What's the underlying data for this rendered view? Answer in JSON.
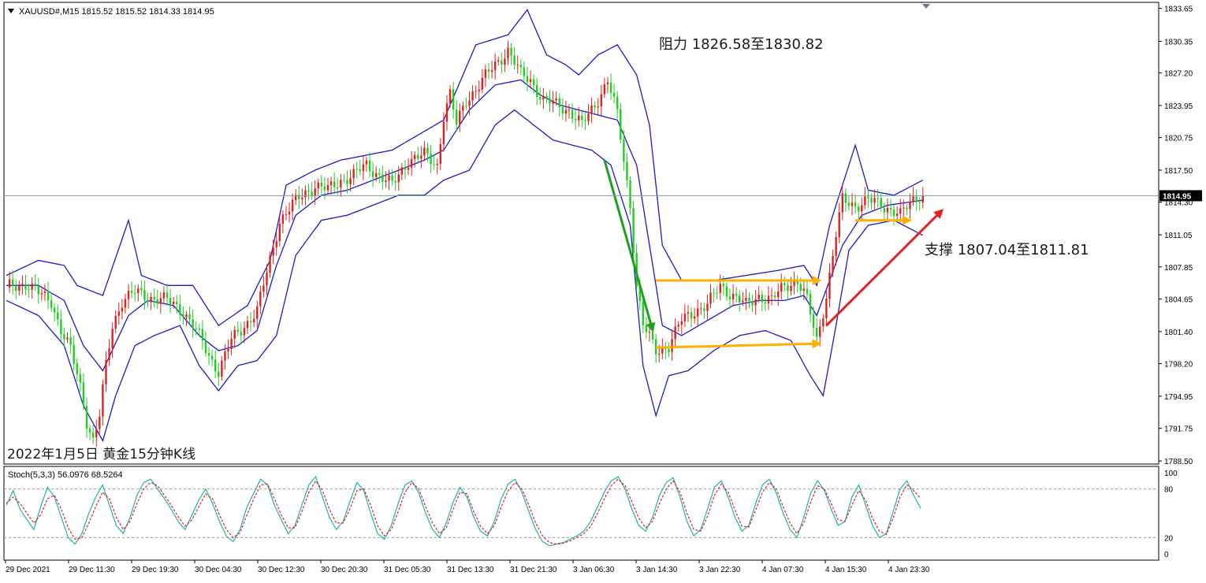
{
  "header": {
    "symbol_info": "XAUUSD#,M15  1815.52 1815.52 1814.33 1814.95",
    "current_price_label": "1814.95",
    "caption": "2022年1月5日 黄金15分钟K线"
  },
  "annotations": {
    "resistance": "阻力 1826.58至1830.82",
    "support": "支撑 1807.04至1811.81"
  },
  "colors": {
    "bull_candle": "#e02020",
    "bear_candle": "#22cc22",
    "bollinger": "#1a1acc",
    "current_price_line": "#7a9aaa",
    "price_badge": "#000000",
    "stoch_main": "#20b2aa",
    "stoch_signal": "#e02020",
    "arrow_down": "#1ea01e",
    "arrow_up": "#e82020",
    "arrow_horizontal": "#ffb000"
  },
  "chart_data": [
    {
      "type": "candlestick",
      "symbol": "XAUUSD#",
      "timeframe": "M15",
      "ylim": [
        1788.5,
        1834.0
      ],
      "y_ticks": [
        "1833.65",
        "1830.35",
        "1827.20",
        "1823.95",
        "1820.75",
        "1817.50",
        "1814.30",
        "1811.05",
        "1807.85",
        "1804.65",
        "1801.40",
        "1798.20",
        "1794.95",
        "1791.75",
        "1788.50"
      ],
      "x_ticks": [
        "29 Dec 2021",
        "29 Dec 11:30",
        "29 Dec 19:30",
        "30 Dec 04:30",
        "30 Dec 12:30",
        "30 Dec 20:30",
        "31 Dec 05:30",
        "31 Dec 13:30",
        "31 Dec 21:30",
        "3 Jan 06:30",
        "3 Jan 14:30",
        "3 Jan 22:30",
        "4 Jan 07:30",
        "4 Jan 15:30",
        "4 Jan 23:30"
      ],
      "current_price": 1814.95,
      "close_path": [
        [
          0,
          1805.8
        ],
        [
          6,
          1806.2
        ],
        [
          10,
          1805.2
        ],
        [
          14,
          1804.5
        ],
        [
          17,
          1801.5
        ],
        [
          20,
          1799.5
        ],
        [
          23,
          1796
        ],
        [
          25,
          1792.5
        ],
        [
          27,
          1790.5
        ],
        [
          29,
          1793
        ],
        [
          31,
          1798
        ],
        [
          33,
          1802
        ],
        [
          36,
          1804.5
        ],
        [
          40,
          1805.3
        ],
        [
          45,
          1804.8
        ],
        [
          50,
          1804.5
        ],
        [
          55,
          1803.5
        ],
        [
          59,
          1801.5
        ],
        [
          63,
          1799
        ],
        [
          66,
          1797.5
        ],
        [
          70,
          1800.5
        ],
        [
          74,
          1802
        ],
        [
          78,
          1803.5
        ],
        [
          82,
          1808.5
        ],
        [
          85,
          1812.5
        ],
        [
          89,
          1814
        ],
        [
          92,
          1815
        ],
        [
          96,
          1816
        ],
        [
          100,
          1815.5
        ],
        [
          104,
          1816.5
        ],
        [
          108,
          1817
        ],
        [
          112,
          1818
        ],
        [
          116,
          1817
        ],
        [
          120,
          1816
        ],
        [
          125,
          1818.5
        ],
        [
          130,
          1819
        ],
        [
          134,
          1818
        ],
        [
          136,
          1823
        ],
        [
          138,
          1825
        ],
        [
          140,
          1822
        ],
        [
          143,
          1824.5
        ],
        [
          147,
          1826
        ],
        [
          152,
          1828
        ],
        [
          156,
          1829.5
        ],
        [
          160,
          1827
        ],
        [
          163,
          1826.5
        ],
        [
          167,
          1824.5
        ],
        [
          171,
          1824
        ],
        [
          175,
          1823.5
        ],
        [
          179,
          1822
        ],
        [
          183,
          1824
        ],
        [
          187,
          1826.5
        ],
        [
          190,
          1823
        ],
        [
          192,
          1818.5
        ],
        [
          194,
          1814
        ],
        [
          196,
          1806
        ],
        [
          198,
          1802
        ],
        [
          202,
          1799.5
        ],
        [
          206,
          1800
        ],
        [
          210,
          1802.5
        ],
        [
          214,
          1803.5
        ],
        [
          218,
          1804
        ],
        [
          222,
          1806
        ],
        [
          226,
          1805
        ],
        [
          230,
          1804
        ],
        [
          234,
          1805
        ],
        [
          238,
          1804.5
        ],
        [
          242,
          1806
        ],
        [
          246,
          1806.5
        ],
        [
          249,
          1804.5
        ],
        [
          252,
          1800.5
        ],
        [
          255,
          1805
        ],
        [
          258,
          1811
        ],
        [
          260,
          1814.5
        ],
        [
          264,
          1814
        ],
        [
          268,
          1814.5
        ],
        [
          272,
          1814
        ],
        [
          276,
          1813.5
        ],
        [
          278,
          1813
        ],
        [
          282,
          1814.5
        ],
        [
          284,
          1815
        ],
        [
          285,
          1814.95
        ]
      ],
      "bollinger_upper": [
        [
          0,
          1807
        ],
        [
          10,
          1808.5
        ],
        [
          18,
          1808
        ],
        [
          22,
          1806
        ],
        [
          30,
          1805
        ],
        [
          38,
          1812.5
        ],
        [
          42,
          1807
        ],
        [
          50,
          1806
        ],
        [
          58,
          1806
        ],
        [
          66,
          1802
        ],
        [
          75,
          1804
        ],
        [
          82,
          1808.5
        ],
        [
          87,
          1816
        ],
        [
          96,
          1817.5
        ],
        [
          104,
          1818.5
        ],
        [
          112,
          1819
        ],
        [
          120,
          1819.5
        ],
        [
          128,
          1821
        ],
        [
          136,
          1822.5
        ],
        [
          146,
          1830
        ],
        [
          156,
          1831
        ],
        [
          162,
          1833.5
        ],
        [
          168,
          1829
        ],
        [
          174,
          1828
        ],
        [
          178,
          1827
        ],
        [
          184,
          1829
        ],
        [
          190,
          1830
        ],
        [
          196,
          1827
        ],
        [
          200,
          1822
        ],
        [
          204,
          1810
        ],
        [
          210,
          1806.5
        ],
        [
          220,
          1806.5
        ],
        [
          230,
          1807
        ],
        [
          240,
          1807.5
        ],
        [
          248,
          1808
        ],
        [
          252,
          1806
        ],
        [
          256,
          1812
        ],
        [
          260,
          1816
        ],
        [
          264,
          1820
        ],
        [
          268,
          1815.5
        ],
        [
          276,
          1815
        ],
        [
          285,
          1816.5
        ]
      ],
      "bollinger_mid": [
        [
          0,
          1806
        ],
        [
          10,
          1806
        ],
        [
          18,
          1804.5
        ],
        [
          24,
          1800
        ],
        [
          30,
          1797.5
        ],
        [
          38,
          1803
        ],
        [
          44,
          1804.5
        ],
        [
          52,
          1804
        ],
        [
          60,
          1801
        ],
        [
          66,
          1799.5
        ],
        [
          72,
          1800
        ],
        [
          78,
          1801.5
        ],
        [
          84,
          1808
        ],
        [
          90,
          1813
        ],
        [
          98,
          1815
        ],
        [
          106,
          1815.5
        ],
        [
          114,
          1816.5
        ],
        [
          122,
          1817.5
        ],
        [
          130,
          1818.5
        ],
        [
          136,
          1819.5
        ],
        [
          144,
          1823.5
        ],
        [
          152,
          1826
        ],
        [
          160,
          1826.5
        ],
        [
          166,
          1825
        ],
        [
          172,
          1824
        ],
        [
          178,
          1823.5
        ],
        [
          184,
          1823
        ],
        [
          190,
          1822.5
        ],
        [
          196,
          1818
        ],
        [
          200,
          1810
        ],
        [
          204,
          1802
        ],
        [
          210,
          1801
        ],
        [
          218,
          1802.5
        ],
        [
          226,
          1804
        ],
        [
          234,
          1804.5
        ],
        [
          242,
          1804.5
        ],
        [
          248,
          1805
        ],
        [
          252,
          1803
        ],
        [
          256,
          1806.5
        ],
        [
          260,
          1810
        ],
        [
          266,
          1813
        ],
        [
          274,
          1814
        ],
        [
          285,
          1814.5
        ]
      ],
      "bollinger_lower": [
        [
          0,
          1804.5
        ],
        [
          10,
          1803
        ],
        [
          18,
          1800
        ],
        [
          24,
          1794
        ],
        [
          30,
          1790.5
        ],
        [
          34,
          1795
        ],
        [
          40,
          1800
        ],
        [
          46,
          1801
        ],
        [
          54,
          1802
        ],
        [
          60,
          1798
        ],
        [
          66,
          1795.5
        ],
        [
          72,
          1798
        ],
        [
          78,
          1798.5
        ],
        [
          84,
          1801
        ],
        [
          90,
          1809
        ],
        [
          98,
          1812.5
        ],
        [
          106,
          1813
        ],
        [
          114,
          1814
        ],
        [
          122,
          1815
        ],
        [
          130,
          1815
        ],
        [
          136,
          1816.5
        ],
        [
          144,
          1817.5
        ],
        [
          152,
          1822
        ],
        [
          158,
          1823.5
        ],
        [
          164,
          1822
        ],
        [
          170,
          1820.5
        ],
        [
          176,
          1820
        ],
        [
          182,
          1819.5
        ],
        [
          188,
          1818
        ],
        [
          194,
          1812
        ],
        [
          198,
          1798
        ],
        [
          202,
          1793
        ],
        [
          206,
          1797
        ],
        [
          212,
          1797.5
        ],
        [
          220,
          1799.5
        ],
        [
          228,
          1801
        ],
        [
          236,
          1801.5
        ],
        [
          244,
          1800.5
        ],
        [
          250,
          1797
        ],
        [
          254,
          1795
        ],
        [
          258,
          1802
        ],
        [
          262,
          1809.5
        ],
        [
          268,
          1812
        ],
        [
          276,
          1812.5
        ],
        [
          282,
          1811.5
        ],
        [
          285,
          1811
        ]
      ],
      "drawings": [
        {
          "kind": "arrow",
          "color": "arrow_down",
          "from": [
            186,
            1818.5
          ],
          "to": [
            201,
            1801.5
          ]
        },
        {
          "kind": "arrow",
          "color": "arrow_horizontal",
          "from": [
            202,
            1806.5
          ],
          "to": [
            253,
            1806.5
          ]
        },
        {
          "kind": "arrow",
          "color": "arrow_horizontal",
          "from": [
            202,
            1799.8
          ],
          "to": [
            253,
            1800.2
          ]
        },
        {
          "kind": "arrow",
          "color": "arrow_horizontal",
          "from": [
            264,
            1812.5
          ],
          "to": [
            281,
            1812.5
          ]
        },
        {
          "kind": "arrow",
          "color": "arrow_up",
          "from": [
            255,
            1802
          ],
          "to": [
            291,
            1813.5
          ]
        }
      ]
    },
    {
      "type": "line",
      "title": "Stoch(5,3,3) 56.0976 68.5264",
      "ylim": [
        0,
        100
      ],
      "y_ticks": [
        100,
        80,
        20,
        0
      ],
      "levels": [
        80,
        20
      ],
      "series": [
        {
          "name": "main",
          "values": [
            60,
            78,
            55,
            42,
            30,
            58,
            82,
            70,
            45,
            20,
            12,
            25,
            50,
            70,
            85,
            60,
            35,
            25,
            45,
            72,
            88,
            92,
            80,
            68,
            55,
            40,
            30,
            48,
            66,
            80,
            62,
            40,
            22,
            15,
            30,
            58,
            75,
            92,
            85,
            60,
            42,
            25,
            35,
            60,
            85,
            95,
            70,
            45,
            30,
            40,
            65,
            88,
            78,
            50,
            25,
            18,
            35,
            62,
            85,
            90,
            75,
            50,
            30,
            20,
            38,
            64,
            82,
            70,
            45,
            28,
            22,
            40,
            68,
            86,
            92,
            76,
            52,
            30,
            15,
            10,
            12,
            14,
            18,
            22,
            28,
            40,
            58,
            76,
            90,
            95,
            80,
            55,
            35,
            28,
            45,
            72,
            88,
            94,
            70,
            40,
            22,
            30,
            55,
            82,
            90,
            70,
            45,
            28,
            35,
            62,
            85,
            92,
            75,
            50,
            30,
            20,
            45,
            75,
            90,
            78,
            55,
            35,
            40,
            70,
            85,
            60,
            35,
            20,
            25,
            52,
            80,
            90,
            72,
            56
          ]
        },
        {
          "name": "signal",
          "values": [
            62,
            70,
            62,
            50,
            38,
            48,
            68,
            72,
            55,
            32,
            18,
            20,
            38,
            58,
            76,
            68,
            45,
            30,
            40,
            62,
            80,
            88,
            84,
            72,
            60,
            46,
            34,
            42,
            58,
            74,
            68,
            48,
            30,
            20,
            26,
            48,
            68,
            85,
            86,
            68,
            48,
            32,
            32,
            52,
            76,
            90,
            78,
            55,
            38,
            38,
            56,
            78,
            80,
            60,
            35,
            22,
            30,
            52,
            76,
            88,
            80,
            58,
            38,
            25,
            32,
            55,
            76,
            74,
            52,
            34,
            25,
            35,
            58,
            78,
            88,
            80,
            60,
            38,
            22,
            14,
            12,
            13,
            16,
            20,
            25,
            34,
            50,
            68,
            84,
            92,
            84,
            64,
            44,
            32,
            40,
            62,
            80,
            90,
            76,
            50,
            30,
            28,
            46,
            72,
            86,
            76,
            54,
            34,
            33,
            54,
            76,
            88,
            80,
            58,
            38,
            25,
            38,
            64,
            84,
            80,
            62,
            42,
            40,
            60,
            78,
            66,
            44,
            28,
            24,
            44,
            70,
            85,
            78,
            68
          ]
        }
      ]
    }
  ]
}
